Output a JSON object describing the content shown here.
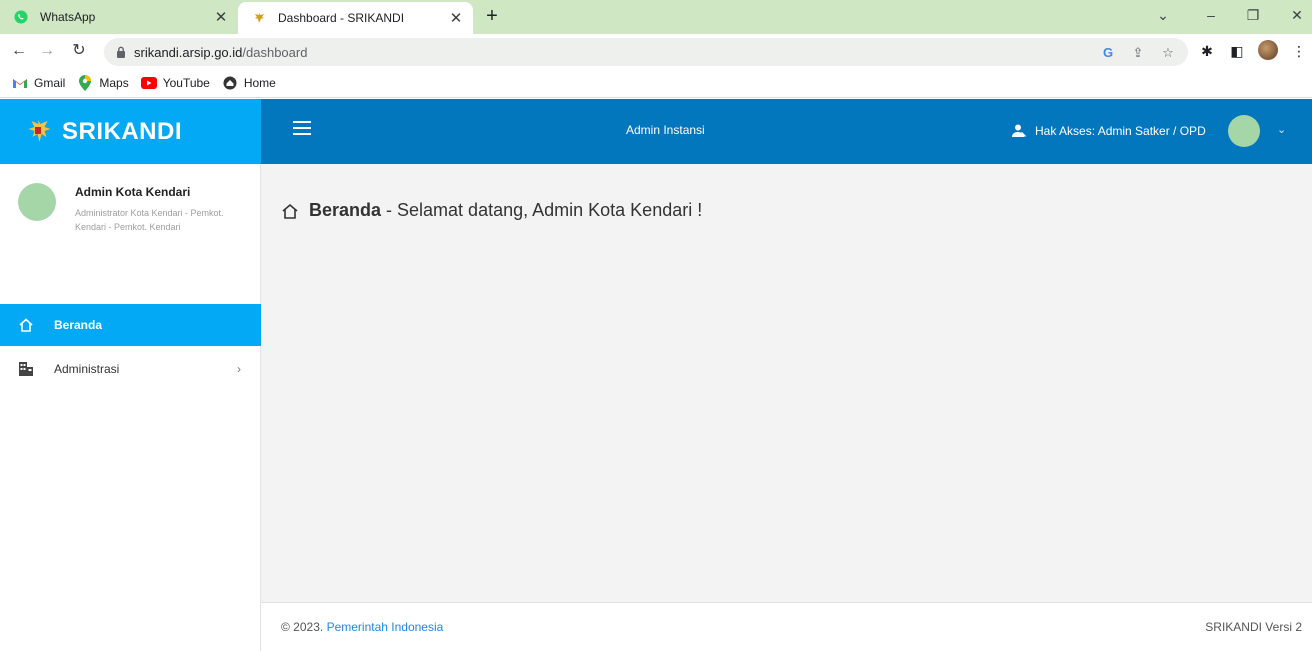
{
  "browser": {
    "tabs": [
      {
        "title": "WhatsApp",
        "icon": "whatsapp-icon",
        "active": false
      },
      {
        "title": "Dashboard - SRIKANDI",
        "icon": "garuda-icon",
        "active": true
      }
    ],
    "url_host": "srikandi.arsip.go.id",
    "url_path": "/dashboard",
    "bookmarks": [
      {
        "label": "Gmail",
        "icon": "gmail-icon"
      },
      {
        "label": "Maps",
        "icon": "maps-icon"
      },
      {
        "label": "YouTube",
        "icon": "youtube-icon"
      },
      {
        "label": "Home",
        "icon": "home-bookmark-icon"
      }
    ]
  },
  "app": {
    "brand": "SRIKANDI",
    "header": {
      "center_label": "Admin Instansi",
      "access_label": "Hak Akses: Admin Satker / OPD"
    },
    "sidebar": {
      "user_name": "Admin Kota Kendari",
      "user_role": "Administrator Kota Kendari - Pemkot. Kendari - Pemkot. Kendari",
      "items": [
        {
          "label": "Beranda",
          "icon": "home-icon",
          "active": true
        },
        {
          "label": "Administrasi",
          "icon": "building-icon",
          "active": false
        }
      ]
    },
    "main": {
      "title_bold": "Beranda",
      "title_rest": "- Selamat datang, Admin Kota Kendari !"
    },
    "footer": {
      "copyright": "© 2023.",
      "link": "Pemerintah Indonesia",
      "version": "SRIKANDI Versi 2"
    },
    "colors": {
      "brand_blue": "#03a9f4",
      "header_blue": "#0277bd",
      "avatar_green": "#a5d6a7"
    }
  }
}
